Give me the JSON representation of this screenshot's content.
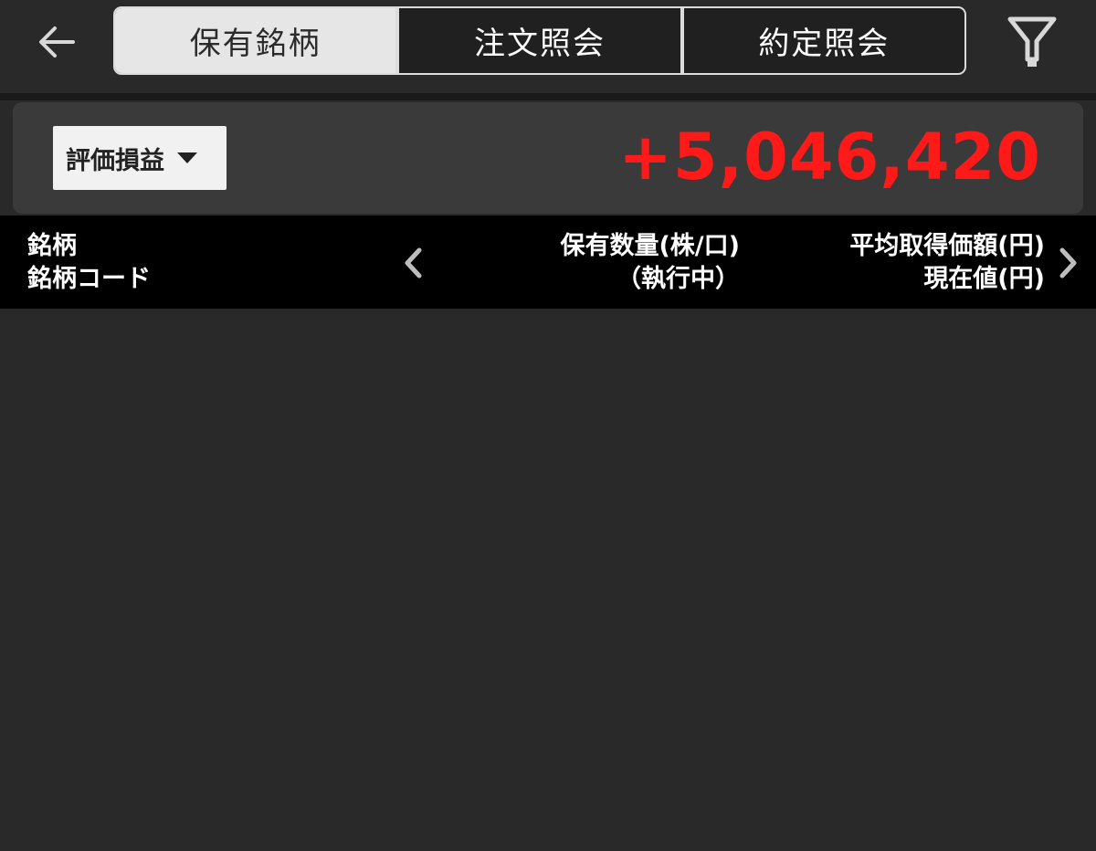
{
  "header": {
    "back_icon": "arrow-left-icon",
    "filter_icon": "filter-icon",
    "tabs": [
      {
        "label": "保有銘柄",
        "active": true
      },
      {
        "label": "注文照会",
        "active": false
      },
      {
        "label": "約定照会",
        "active": false
      }
    ]
  },
  "summary": {
    "dropdown_label": "評価損益",
    "dropdown_icon": "caret-down-icon",
    "value": "+5,046,420",
    "value_color": "#ff1a1a"
  },
  "columns": {
    "left_line1": "銘柄",
    "left_line2": "銘柄コード",
    "mid_line1": "保有数量(株/口)",
    "mid_line2": "（執行中）",
    "right_line1": "平均取得価額(円)",
    "right_line2": "現在値(円)",
    "prev_icon": "chevron-left-icon",
    "next_icon": "chevron-right-icon"
  },
  "colors": {
    "background": "#292929",
    "card": "#3a3a3a",
    "header_band": "#000000",
    "active_tab": "#e6e6e6",
    "accent_red": "#ff1a1a"
  }
}
